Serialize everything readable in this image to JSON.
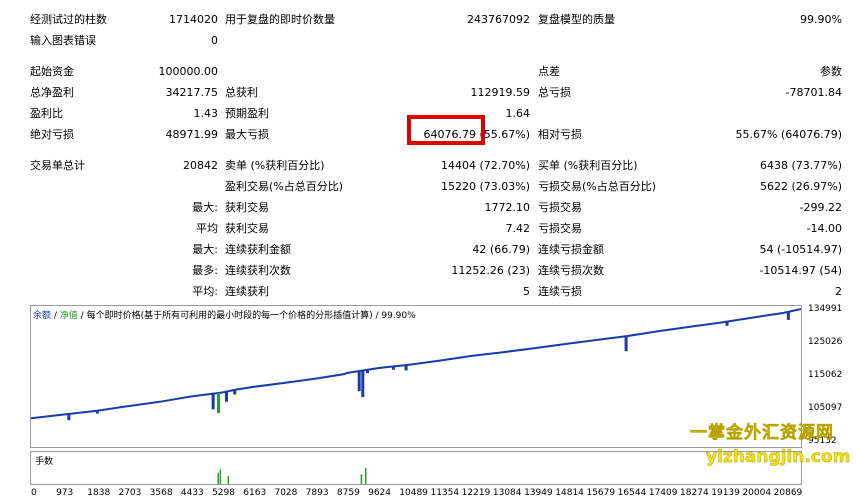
{
  "summary": {
    "bars_tested_label": "经测试过的柱数",
    "bars_tested": "1714020",
    "ticks_label": "用于复盘的即时价数量",
    "ticks": "243767092",
    "quality_label": "复盘模型的质量",
    "quality": "99.90%",
    "errors_label": "输入图表错误",
    "errors": "0",
    "initial_deposit_label": "起始资金",
    "initial_deposit": "100000.00",
    "spread_label": "点差",
    "spread": "参数",
    "net_profit_label": "总净盈利",
    "net_profit": "34217.75",
    "gross_profit_label": "总获利",
    "gross_profit": "112919.59",
    "gross_loss_label": "总亏损",
    "gross_loss": "-78701.84",
    "profit_factor_label": "盈利比",
    "profit_factor": "1.43",
    "expected_payoff_label": "预期盈利",
    "expected_payoff": "1.64",
    "abs_dd_label": "绝对亏损",
    "abs_dd": "48971.99",
    "max_dd_label": "最大亏损",
    "max_dd": "64076.79 (55.67%)",
    "rel_dd_label": "相对亏损",
    "rel_dd": "55.67% (64076.79)",
    "total_trades_label": "交易单总计",
    "total_trades": "20842",
    "short_label": "卖单 (%获利百分比)",
    "short": "14404 (72.70%)",
    "long_label": "买单 (%获利百分比)",
    "long": "6438 (73.77%)",
    "profit_trades_label": "盈利交易(%占总百分比)",
    "profit_trades": "15220 (73.03%)",
    "loss_trades_label": "亏损交易(%占总百分比)",
    "loss_trades": "5622 (26.97%)",
    "largest_label": "最大:",
    "largest_profit_label": "获利交易",
    "largest_profit": "1772.10",
    "largest_loss_label": "亏损交易",
    "largest_loss": "-299.22",
    "average_label": "平均",
    "avg_profit_label": "获利交易",
    "avg_profit": "7.42",
    "avg_loss_label": "亏损交易",
    "avg_loss": "-14.00",
    "max_consec_label": "最大:",
    "max_consec_wins_label": "连续获利金额",
    "max_consec_wins": "42 (66.79)",
    "max_consec_losses_label": "连续亏损金额",
    "max_consec_losses": "54 (-10514.97)",
    "maximal_label": "最多:",
    "maximal_wins_label": "连续获利次数",
    "maximal_wins": "11252.26 (23)",
    "maximal_losses_label": "连续亏损次数",
    "maximal_losses": "-10514.97 (54)",
    "avg_consec_label": "平均:",
    "avg_consec_wins_label": "连续获利",
    "avg_consec_wins": "5",
    "avg_consec_losses_label": "连续亏损",
    "avg_consec_losses": "2"
  },
  "chart_header": {
    "balance": "余额",
    "sep1": " / ",
    "equity": "净值",
    "sep2": " / ",
    "rest": "每个即时价格(基于所有可利用的最小时段的每一个价格的分形插值计算) / 99.90%"
  },
  "volume_label": "手数",
  "watermark": {
    "line1": "一掌金外汇资源网",
    "line2": "yizhangjin.com"
  },
  "colors": {
    "balance": "#1a3aa8",
    "equity": "#2a9a2a",
    "highlight": "#e00000",
    "watermark": "#f3e312"
  },
  "chart_data": {
    "type": "line",
    "yticks": [
      "134991",
      "125026",
      "115062",
      "105097",
      "95132"
    ],
    "xticks": [
      "0",
      "973",
      "1838",
      "2703",
      "3568",
      "4433",
      "5298",
      "6163",
      "7028",
      "7893",
      "8759",
      "9624",
      "10489",
      "11354",
      "12219",
      "13084",
      "13949",
      "14814",
      "15679",
      "16544",
      "17409",
      "18274",
      "19139",
      "20004",
      "20869"
    ],
    "ylim": [
      95132,
      134991
    ],
    "xlim": [
      0,
      20869
    ],
    "series": [
      {
        "name": "余额",
        "x": [
          0,
          973,
          1838,
          2703,
          3568,
          4433,
          5298,
          5700,
          6163,
          7028,
          7893,
          8700,
          8759,
          9624,
          10489,
          11354,
          12219,
          13084,
          13949,
          14814,
          15679,
          16544,
          17409,
          18274,
          19139,
          20004,
          20869,
          21350
        ],
        "values": [
          102300,
          103500,
          104600,
          106000,
          107300,
          108900,
          110100,
          111000,
          111800,
          113000,
          114300,
          115700,
          116000,
          117500,
          118500,
          119800,
          121200,
          122300,
          123500,
          124800,
          126000,
          127200,
          128700,
          130000,
          131300,
          132800,
          134200,
          135400
        ]
      }
    ],
    "dips": [
      {
        "x": 1050,
        "values": [
          101700
        ]
      },
      {
        "x": 1840,
        "values": [
          103700
        ]
      },
      {
        "x": 5050,
        "values": [
          105000
        ]
      },
      {
        "x": 5200,
        "values": [
          103900
        ]
      },
      {
        "x": 5420,
        "values": [
          107300
        ]
      },
      {
        "x": 5650,
        "values": [
          109500
        ]
      },
      {
        "x": 9100,
        "values": [
          110500
        ]
      },
      {
        "x": 9200,
        "values": [
          108700
        ]
      },
      {
        "x": 9330,
        "values": [
          116000
        ]
      },
      {
        "x": 10050,
        "values": [
          117000
        ]
      },
      {
        "x": 10400,
        "values": [
          116800
        ]
      },
      {
        "x": 16500,
        "values": [
          122600
        ]
      },
      {
        "x": 19300,
        "values": [
          130300
        ]
      },
      {
        "x": 21000,
        "values": [
          132100
        ]
      }
    ],
    "volume": [
      {
        "x": 5170,
        "v": 0.7
      },
      {
        "x": 5230,
        "v": 0.9
      },
      {
        "x": 5450,
        "v": 0.5
      },
      {
        "x": 9140,
        "v": 0.6
      },
      {
        "x": 9260,
        "v": 1.0
      }
    ]
  }
}
